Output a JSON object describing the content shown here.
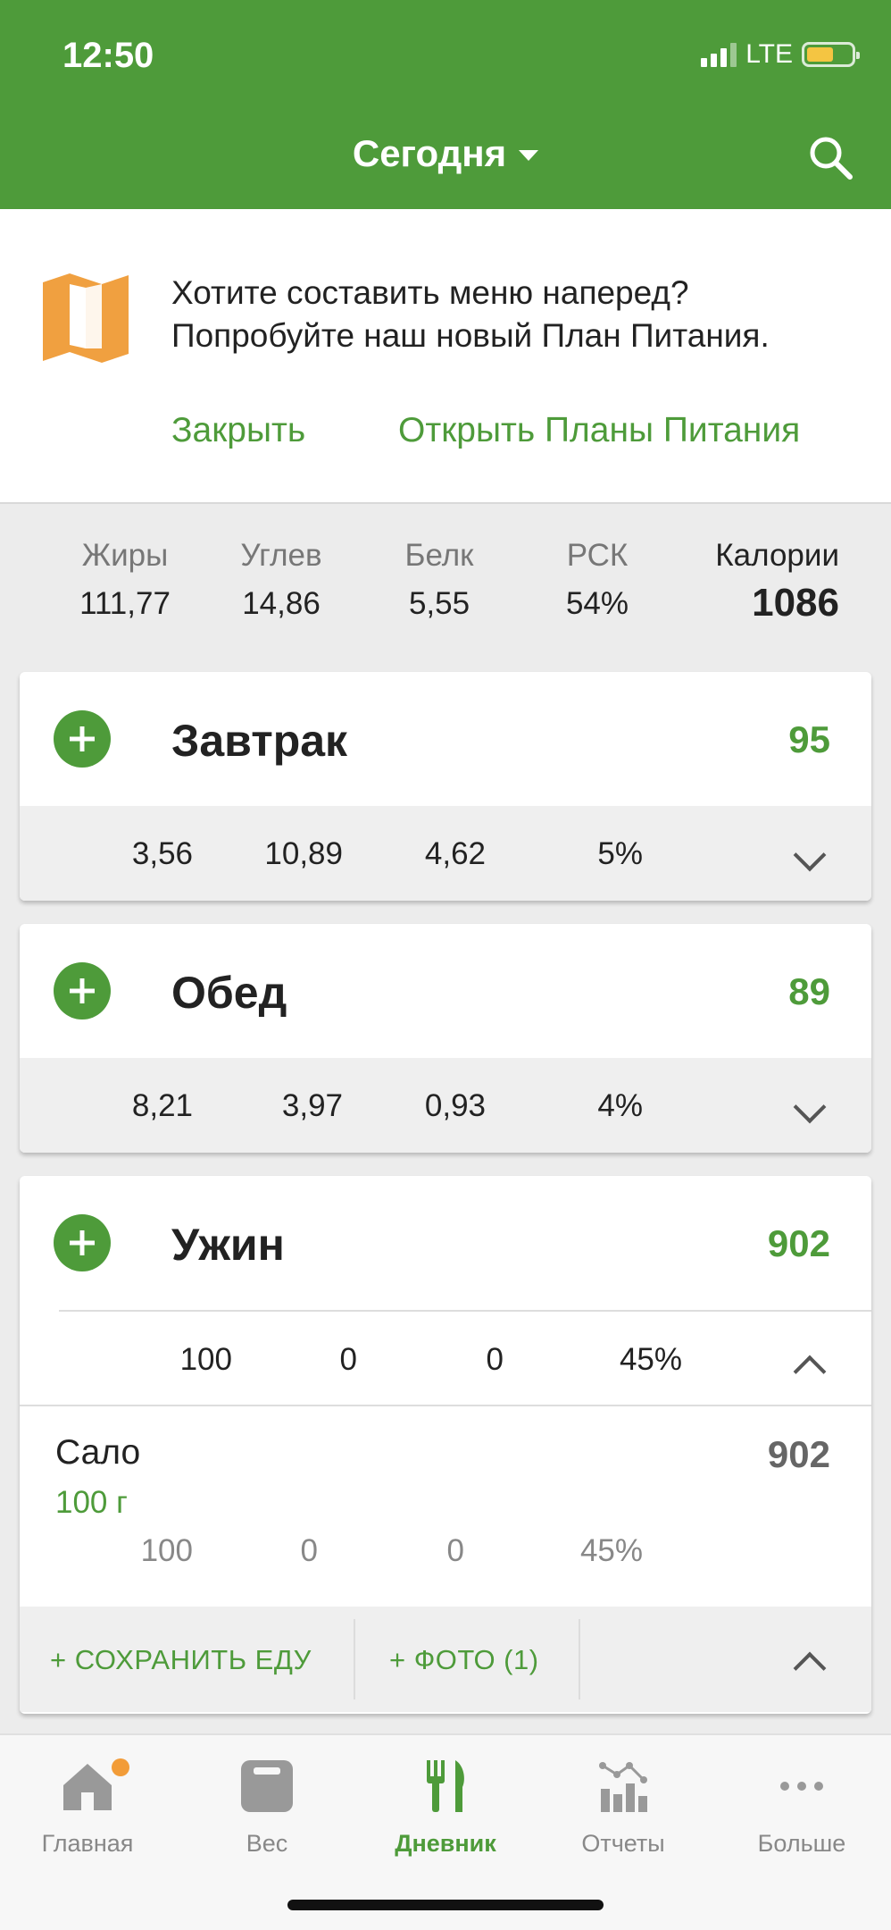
{
  "status_bar": {
    "time": "12:50",
    "network": "LTE"
  },
  "header": {
    "title": "Сегодня"
  },
  "promo": {
    "line1": "Хотите составить меню наперед?",
    "line2": "Попробуйте наш новый План Питания.",
    "close_label": "Закрыть",
    "open_label": "Открыть Планы Питания"
  },
  "summary": {
    "labels": [
      "Жиры",
      "Углев",
      "Белк",
      "РСК",
      "Калории"
    ],
    "values": [
      "111,77",
      "14,86",
      "5,55",
      "54%",
      "1086"
    ]
  },
  "meals": [
    {
      "name": "Завтрак",
      "calories": "95",
      "macros": [
        "3,56",
        "10,89",
        "4,62",
        "5%"
      ]
    },
    {
      "name": "Обед",
      "calories": "89",
      "macros": [
        "8,21",
        "3,97",
        "0,93",
        "4%"
      ]
    },
    {
      "name": "Ужин",
      "calories": "902",
      "macros": [
        "100",
        "0",
        "0",
        "45%"
      ],
      "foods": [
        {
          "name": "Сало",
          "amount": "100 г",
          "calories": "902",
          "macros": [
            "100",
            "0",
            "0",
            "45%"
          ]
        }
      ],
      "actions": {
        "save": "+ СОХРАНИТЬ ЕДУ",
        "photo": "+ ФОТО (1)"
      }
    }
  ],
  "nav": {
    "items": [
      "Главная",
      "Вес",
      "Дневник",
      "Отчеты",
      "Больше"
    ],
    "active": "Дневник"
  },
  "colors": {
    "brand": "#4e9b3a",
    "accent": "#f29c38",
    "promo_icon": "#f0a040"
  }
}
